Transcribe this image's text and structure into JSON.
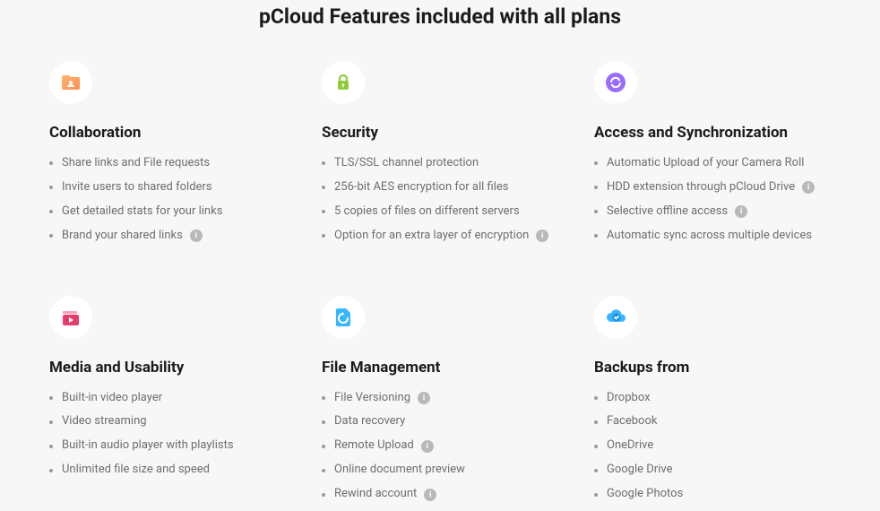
{
  "title": "pCloud Features included with all plans",
  "features": [
    {
      "id": "collaboration",
      "icon": "folder-user-icon",
      "title": "Collaboration",
      "items": [
        {
          "text": "Share links and File requests",
          "info": false
        },
        {
          "text": "Invite users to shared folders",
          "info": false
        },
        {
          "text": "Get detailed stats for your links",
          "info": false
        },
        {
          "text": "Brand your shared links",
          "info": true
        }
      ]
    },
    {
      "id": "security",
      "icon": "lock-icon",
      "title": "Security",
      "items": [
        {
          "text": "TLS/SSL channel protection",
          "info": false
        },
        {
          "text": "256-bit AES encryption for all files",
          "info": false
        },
        {
          "text": "5 copies of files on different servers",
          "info": false
        },
        {
          "text": "Option for an extra layer of encryption",
          "info": true
        }
      ]
    },
    {
      "id": "access-sync",
      "icon": "sync-icon",
      "title": "Access and Synchronization",
      "items": [
        {
          "text": "Automatic Upload of your Camera Roll",
          "info": false
        },
        {
          "text": "HDD extension through pCloud Drive",
          "info": true
        },
        {
          "text": "Selective offline access",
          "info": true
        },
        {
          "text": "Automatic sync across multiple devices",
          "info": false
        }
      ]
    },
    {
      "id": "media-usability",
      "icon": "play-icon",
      "title": "Media and Usability",
      "items": [
        {
          "text": "Built-in video player",
          "info": false
        },
        {
          "text": "Video streaming",
          "info": false
        },
        {
          "text": "Built-in audio player with playlists",
          "info": false
        },
        {
          "text": "Unlimited file size and speed",
          "info": false
        }
      ]
    },
    {
      "id": "file-management",
      "icon": "restore-icon",
      "title": "File Management",
      "items": [
        {
          "text": "File Versioning",
          "info": true
        },
        {
          "text": "Data recovery",
          "info": false
        },
        {
          "text": "Remote Upload",
          "info": true
        },
        {
          "text": "Online document preview",
          "info": false
        },
        {
          "text": "Rewind account",
          "info": true
        }
      ]
    },
    {
      "id": "backups",
      "icon": "cloud-check-icon",
      "title": "Backups from",
      "items": [
        {
          "text": "Dropbox",
          "info": false
        },
        {
          "text": "Facebook",
          "info": false
        },
        {
          "text": "OneDrive",
          "info": false
        },
        {
          "text": "Google Drive",
          "info": false
        },
        {
          "text": "Google Photos",
          "info": false
        }
      ]
    }
  ]
}
